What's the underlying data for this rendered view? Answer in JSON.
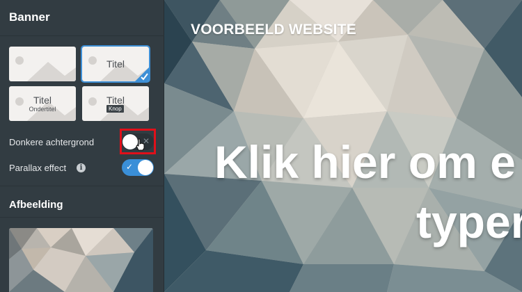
{
  "sidebar": {
    "banner_title": "Banner",
    "layouts": [
      {
        "title": "",
        "subtitle": "",
        "button": ""
      },
      {
        "title": "Titel",
        "subtitle": "",
        "button": "",
        "selected": true
      },
      {
        "title": "Titel",
        "subtitle": "Ondertitel",
        "button": ""
      },
      {
        "title": "Titel",
        "subtitle": "",
        "button": "Knop"
      }
    ],
    "dark_bg_label": "Donkere achtergrond",
    "dark_bg_on": false,
    "parallax_label": "Parallax effect",
    "parallax_on": true,
    "info_glyph": "i",
    "image_title": "Afbeelding"
  },
  "preview": {
    "site_title": "VOORBEELD WEBSITE",
    "hero_line1": "Klik hier om e",
    "hero_line2": "typer"
  },
  "colors": {
    "sidebar": "#323c42",
    "accent": "#3a8fd8",
    "highlight": "#e0101a"
  }
}
